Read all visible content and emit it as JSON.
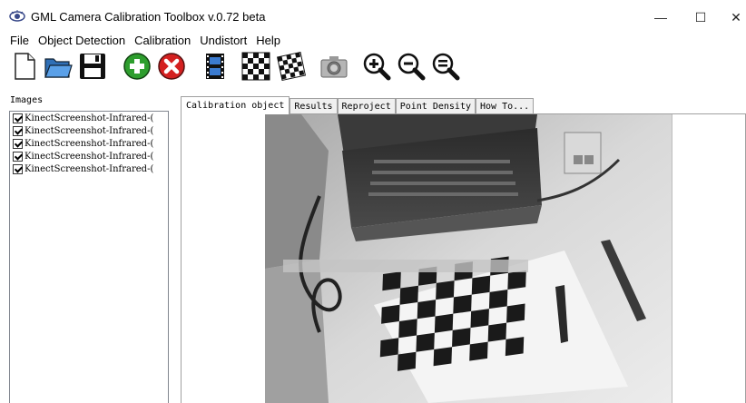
{
  "window": {
    "title": "GML Camera Calibration Toolbox  v.0.72 beta",
    "minimize": "—",
    "maximize": "☐",
    "close": "✕"
  },
  "menu": [
    "File",
    "Object Detection",
    "Calibration",
    "Undistort",
    "Help"
  ],
  "toolbar": {
    "buttons": [
      {
        "name": "new-icon"
      },
      {
        "name": "open-folder-icon"
      },
      {
        "name": "save-icon"
      },
      {
        "name": "add-icon"
      },
      {
        "name": "remove-icon"
      },
      {
        "name": "film-icon"
      },
      {
        "name": "checkerboard-icon"
      },
      {
        "name": "checkerboard-detect-icon"
      },
      {
        "name": "camera-icon"
      },
      {
        "name": "zoom-in-icon"
      },
      {
        "name": "zoom-out-icon"
      },
      {
        "name": "zoom-fit-icon"
      }
    ]
  },
  "images_panel": {
    "label": "Images",
    "items": [
      {
        "name": "KinectScreenshot-Infrared-(",
        "checked": true
      },
      {
        "name": "KinectScreenshot-Infrared-(",
        "checked": true
      },
      {
        "name": "KinectScreenshot-Infrared-(",
        "checked": true
      },
      {
        "name": "KinectScreenshot-Infrared-(",
        "checked": true
      },
      {
        "name": "KinectScreenshot-Infrared-(",
        "checked": true
      }
    ]
  },
  "tabs": [
    "Calibration object",
    "Results",
    "Reproject",
    "Point Density",
    "How To..."
  ],
  "active_tab": 0,
  "colors": {
    "add_button": "#2e9e2e",
    "remove_button": "#d42020",
    "zoom_lens": "#2a6fb0"
  }
}
